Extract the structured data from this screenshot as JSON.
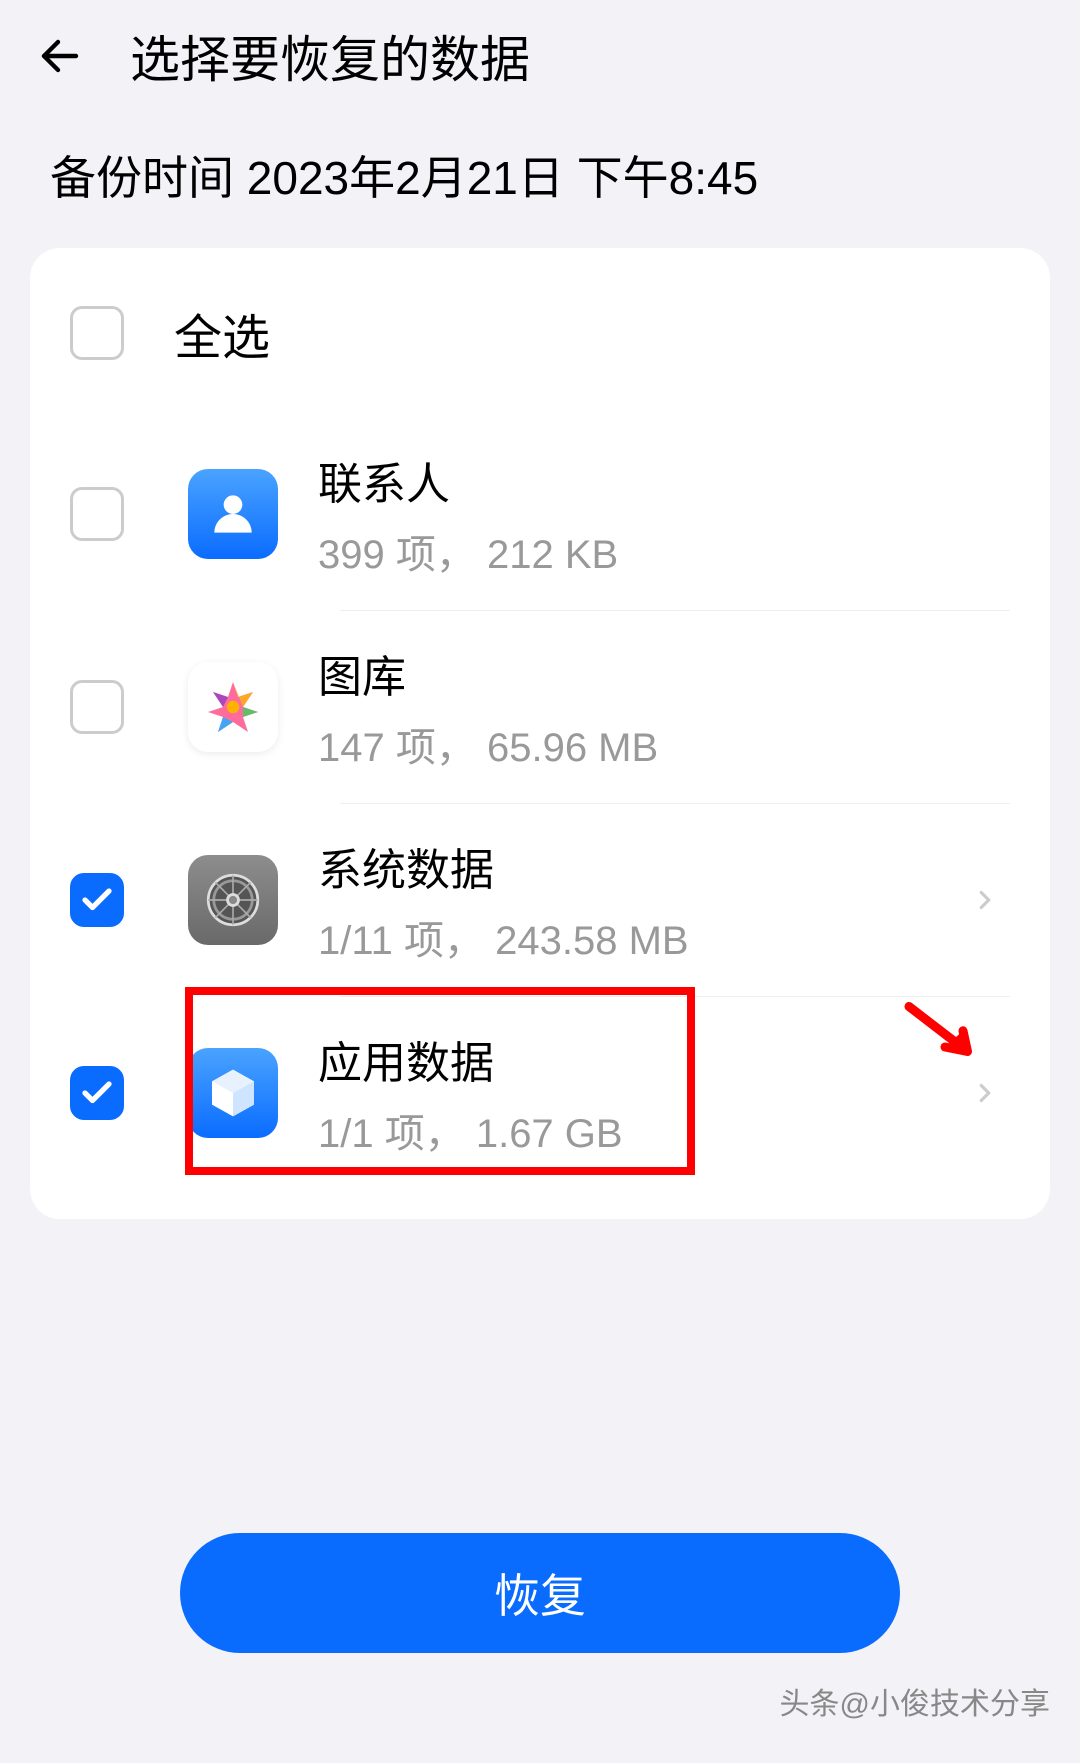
{
  "header": {
    "title": "选择要恢复的数据"
  },
  "backup_time": "备份时间 2023年2月21日 下午8:45",
  "select_all": {
    "label": "全选",
    "checked": false
  },
  "items": [
    {
      "title": "联系人",
      "subtitle": "399 项， 212 KB",
      "checked": false,
      "has_chevron": false,
      "icon": "contacts-icon"
    },
    {
      "title": "图库",
      "subtitle": "147 项， 65.96 MB",
      "checked": false,
      "has_chevron": false,
      "icon": "gallery-icon"
    },
    {
      "title": "系统数据",
      "subtitle": "1/11 项， 243.58 MB",
      "checked": true,
      "has_chevron": true,
      "icon": "system-icon"
    },
    {
      "title": "应用数据",
      "subtitle": "1/1 项， 1.67 GB",
      "checked": true,
      "has_chevron": true,
      "icon": "app-icon",
      "highlighted": true
    }
  ],
  "restore_button": "恢复",
  "watermark": "头条@小俊技术分享"
}
